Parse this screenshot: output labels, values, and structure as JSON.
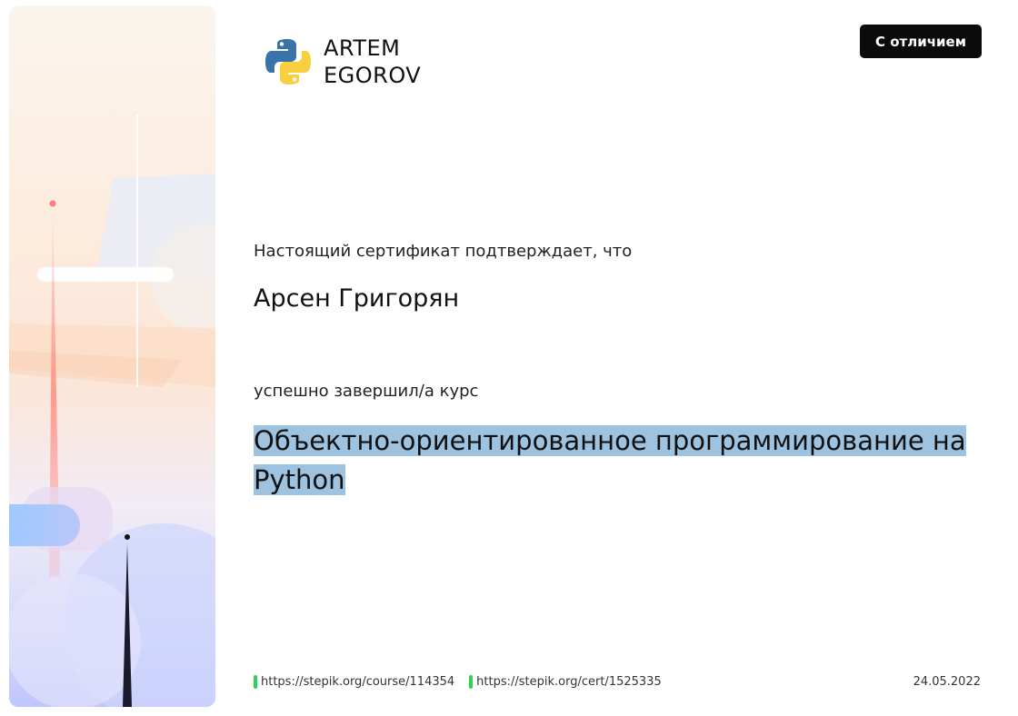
{
  "author": {
    "first": "ARTEM",
    "last": "EGOROV",
    "logo_icon": "python-logo-icon"
  },
  "badge": {
    "label": "С отличием"
  },
  "certificate": {
    "intro": "Настоящий сертификат подтверждает, что",
    "recipient": "Арсен Григорян",
    "completed": "успешно завершил/а  курс",
    "course_title": "Объектно-ориентированное программирование на Python"
  },
  "footer": {
    "course_link": "https://stepik.org/course/114354",
    "cert_link": "https://stepik.org/cert/1525335",
    "date": "24.05.2022"
  },
  "colors": {
    "badge_bg": "#0b0b0b",
    "highlight": "#9dc3e0",
    "link_marker": "#2fcf59"
  }
}
